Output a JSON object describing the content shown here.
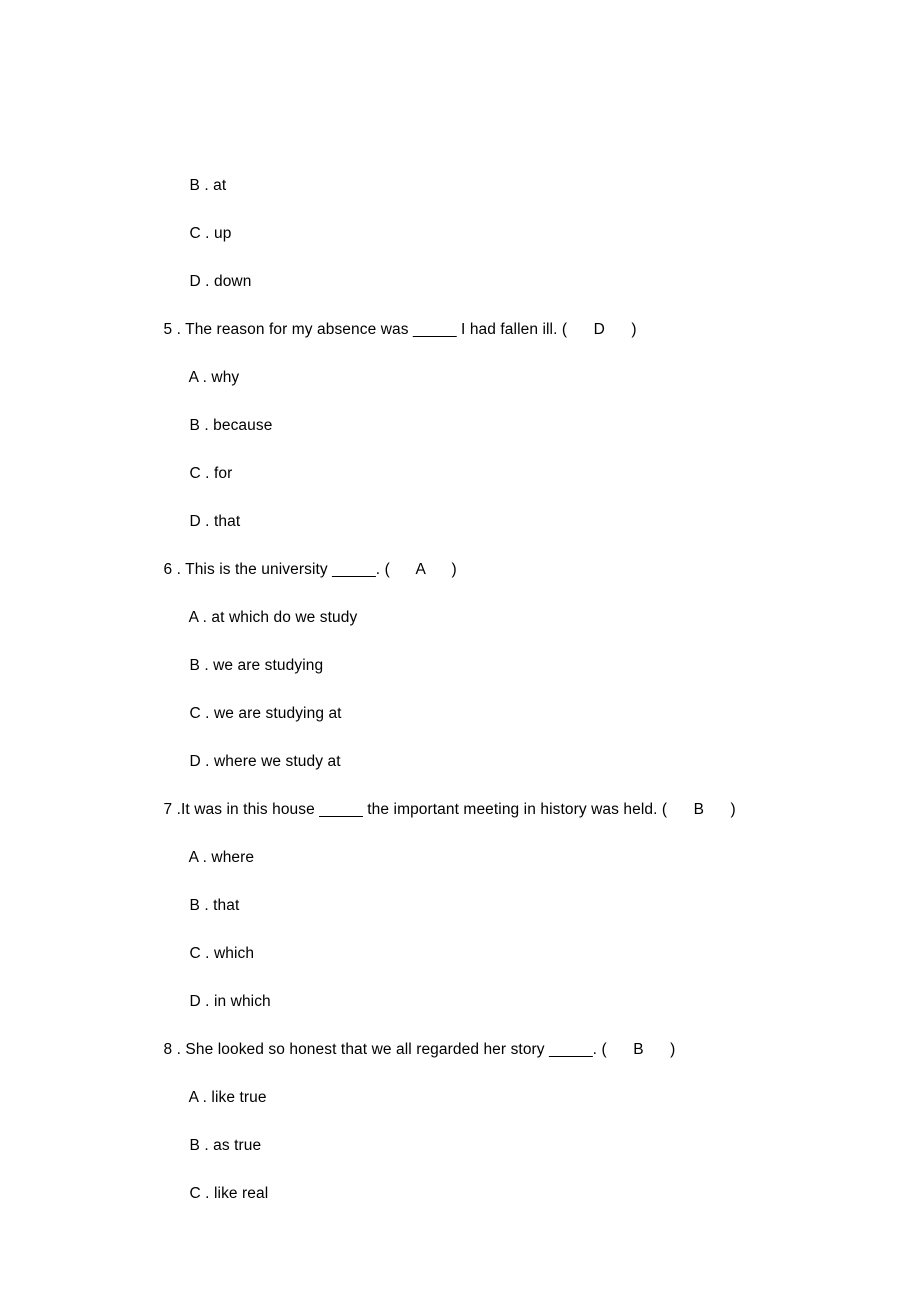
{
  "document": {
    "type": "multiple-choice-exercise",
    "page_background": "#ffffff",
    "text_color": "#000000",
    "continued_from_previous_page": true
  },
  "orphan_options": [
    {
      "label": "B",
      "separator": " . ",
      "text": "at"
    },
    {
      "label": "C",
      "separator": " . ",
      "text": "up"
    },
    {
      "label": "D",
      "separator": " . ",
      "text": "down"
    }
  ],
  "questions": [
    {
      "number": "5",
      "number_separator": " . ",
      "stem_before_blank": "The reason for my absence was ",
      "blank": "_____",
      "stem_after_blank": " I had fallen ill. ",
      "answer_open": "(",
      "answer": "D",
      "answer_close": ")",
      "options": [
        {
          "label": "A",
          "separator": " . ",
          "text": "why"
        },
        {
          "label": "B",
          "separator": " . ",
          "text": "because"
        },
        {
          "label": "C",
          "separator": " . ",
          "text": "for"
        },
        {
          "label": "D",
          "separator": " . ",
          "text": "that"
        }
      ]
    },
    {
      "number": "6",
      "number_separator": " . ",
      "stem_before_blank": "This is the university ",
      "blank": "_____",
      "stem_after_blank": ". ",
      "answer_open": "(",
      "answer": "A",
      "answer_close": ")",
      "options": [
        {
          "label": "A",
          "separator": " . ",
          "text": "at which do we study"
        },
        {
          "label": "B",
          "separator": " . ",
          "text": "we are studying"
        },
        {
          "label": "C",
          "separator": " . ",
          "text": "we are studying at"
        },
        {
          "label": "D",
          "separator": " . ",
          "text": "where we study at"
        }
      ]
    },
    {
      "number": "7",
      "number_separator": " .",
      "stem_before_blank": "It was in this house ",
      "blank": "_____",
      "stem_after_blank": " the important meeting in history was held. ",
      "answer_open": "(",
      "answer": "B",
      "answer_close": ")",
      "options": [
        {
          "label": "A",
          "separator": " . ",
          "text": "where"
        },
        {
          "label": "B",
          "separator": " . ",
          "text": "that"
        },
        {
          "label": "C",
          "separator": " . ",
          "text": "which"
        },
        {
          "label": "D",
          "separator": " . ",
          "text": "in which"
        }
      ]
    },
    {
      "number": "8",
      "number_separator": " . ",
      "stem_before_blank": "She looked so honest that we all regarded her story ",
      "blank": "_____",
      "stem_after_blank": ". ",
      "answer_open": "(",
      "answer": "B",
      "answer_close": ")",
      "options": [
        {
          "label": "A",
          "separator": " . ",
          "text": "like true"
        },
        {
          "label": "B",
          "separator": " . ",
          "text": "as true"
        },
        {
          "label": "C",
          "separator": " . ",
          "text": "like real"
        }
      ]
    }
  ],
  "answer_gap_before": "      ",
  "answer_gap_after": "      "
}
